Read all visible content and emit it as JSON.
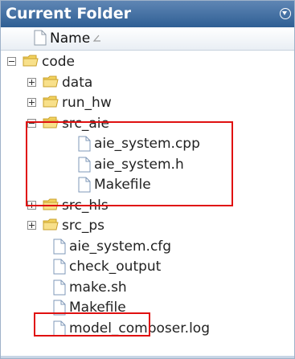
{
  "panel": {
    "title": "Current Folder",
    "column_header": "Name",
    "sort_indicator": "ascending"
  },
  "tree": [
    {
      "label": "code",
      "type": "folder",
      "depth": 0,
      "state": "expanded"
    },
    {
      "label": "data",
      "type": "folder",
      "depth": 1,
      "state": "collapsed"
    },
    {
      "label": "run_hw",
      "type": "folder",
      "depth": 1,
      "state": "collapsed"
    },
    {
      "label": "src_aie",
      "type": "folder",
      "depth": 1,
      "state": "expanded"
    },
    {
      "label": "aie_system.cpp",
      "type": "file",
      "depth": 2
    },
    {
      "label": "aie_system.h",
      "type": "file",
      "depth": 2
    },
    {
      "label": "Makefile",
      "type": "file",
      "depth": 2
    },
    {
      "label": "src_hls",
      "type": "folder",
      "depth": 1,
      "state": "collapsed"
    },
    {
      "label": "src_ps",
      "type": "folder",
      "depth": 1,
      "state": "collapsed"
    },
    {
      "label": "aie_system.cfg",
      "type": "file",
      "depth": 1
    },
    {
      "label": "check_output",
      "type": "file",
      "depth": 1
    },
    {
      "label": "make.sh",
      "type": "file",
      "depth": 1
    },
    {
      "label": "Makefile",
      "type": "file",
      "depth": 1
    },
    {
      "label": "model_composer.log",
      "type": "file",
      "depth": 1
    }
  ],
  "colors": {
    "title_bg": "#3f6da3",
    "folder": "#f3d35f",
    "highlight": "#e01010"
  }
}
